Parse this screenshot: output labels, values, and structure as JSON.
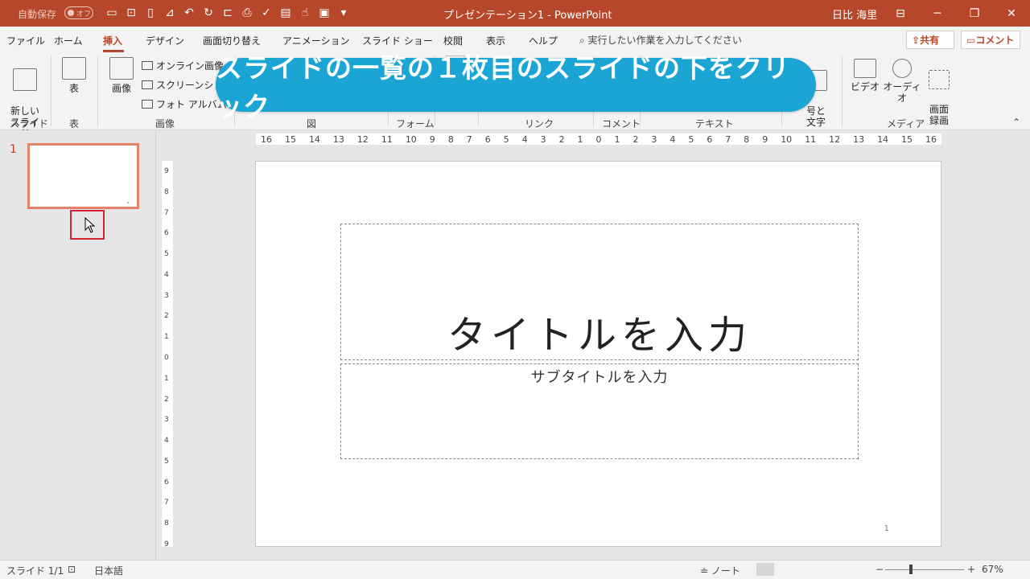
{
  "titlebar": {
    "autosave_label": "自動保存",
    "autosave_state": "オフ",
    "doc_title": "プレゼンテーション1  -  PowerPoint",
    "user": "日比 海里"
  },
  "tabs": [
    {
      "label": "ファイル"
    },
    {
      "label": "ホーム"
    },
    {
      "label": "挿入"
    },
    {
      "label": "デザイン"
    },
    {
      "label": "画面切り替え"
    },
    {
      "label": "アニメーション"
    },
    {
      "label": "スライド ショー"
    },
    {
      "label": "校閲"
    },
    {
      "label": "表示"
    },
    {
      "label": "ヘルプ"
    }
  ],
  "tell_me": "実行したい作業を入力してください",
  "share_label": "共有",
  "comment_label": "コメント",
  "ribbon": {
    "new_slide": "新しい\nスライド",
    "table": "表",
    "image": "画像",
    "online_image": "オンライン画像",
    "screenshot": "スクリーンショット",
    "photo_album": "フォト アルバム",
    "symbols_partial": "号と\n文字",
    "video": "ビデオ",
    "audio": "オーディオ",
    "screen_record": "画面\n録画",
    "groups": {
      "slides": "スライド",
      "tables": "表",
      "images": "画像",
      "illustrations": "図",
      "forms": "フォーム",
      "links": "リンク",
      "comments": "コメント",
      "text": "テキスト",
      "media": "メディア"
    }
  },
  "banner": "スライドの一覧の１枚目のスライドの下をクリック",
  "thumbnails": [
    {
      "number": "1"
    }
  ],
  "hruler": [
    "16",
    "15",
    "14",
    "13",
    "12",
    "11",
    "10",
    "9",
    "8",
    "7",
    "6",
    "5",
    "4",
    "3",
    "2",
    "1",
    "0",
    "1",
    "2",
    "3",
    "4",
    "5",
    "6",
    "7",
    "8",
    "9",
    "10",
    "11",
    "12",
    "13",
    "14",
    "15",
    "16"
  ],
  "vruler": [
    "9",
    "8",
    "7",
    "6",
    "5",
    "4",
    "3",
    "2",
    "1",
    "0",
    "1",
    "2",
    "3",
    "4",
    "5",
    "6",
    "7",
    "8",
    "9"
  ],
  "slide": {
    "title_placeholder": "タイトルを入力",
    "subtitle_placeholder": "サブタイトルを入力",
    "page_number": "1"
  },
  "statusbar": {
    "slide_count": "スライド 1/1",
    "language": "日本語",
    "notes": "ノート",
    "zoom": "67%"
  },
  "colors": {
    "accent": "#b7472a",
    "banner": "#1aa5d4",
    "highlight_box": "#d4242f"
  }
}
